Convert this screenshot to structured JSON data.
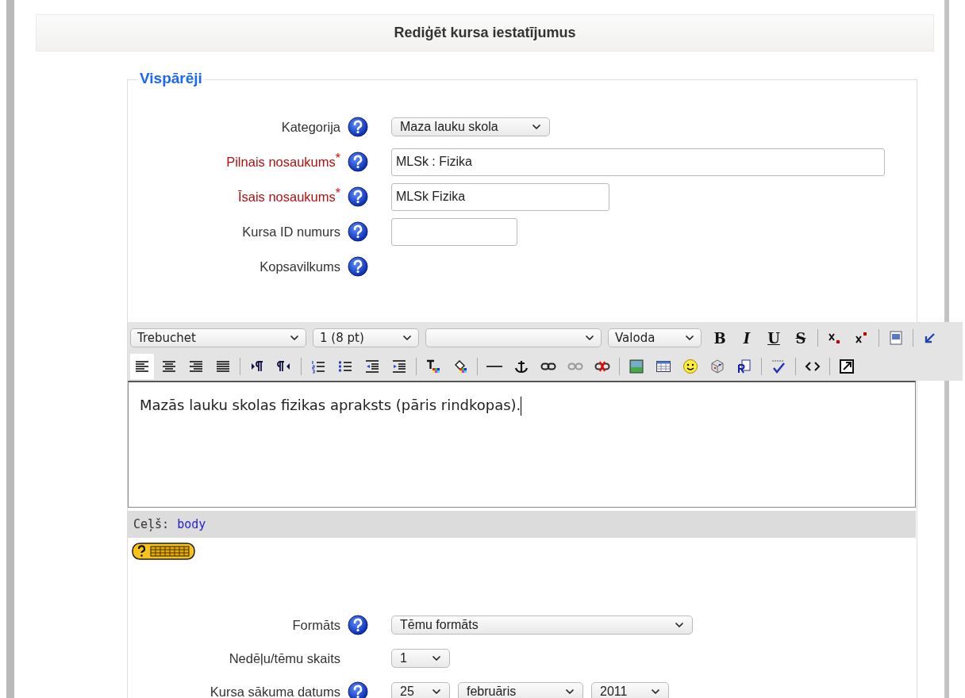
{
  "header": {
    "title": "Rediģēt kursa iestatījumus"
  },
  "section": {
    "legend": "Vispārēji"
  },
  "fields": [
    {
      "label": "Kategorija",
      "required": false,
      "help": true,
      "kind": "select",
      "value": "Maza lauku skola"
    },
    {
      "label": "Pilnais nosaukums",
      "required": true,
      "required_mark": "*",
      "help": true,
      "kind": "text",
      "value": "MLSk : Fizika"
    },
    {
      "label": "Īsais nosaukums",
      "required": true,
      "required_mark": "*",
      "help": true,
      "kind": "text",
      "value": "MLSk Fizika"
    },
    {
      "label": "Kursa ID numurs",
      "required": false,
      "help": true,
      "kind": "text"
    },
    {
      "label": "Kopsavilkums",
      "required": false,
      "help": true,
      "kind": "none"
    }
  ],
  "editor": {
    "toolbar_rows": [
      {
        "items": [
          {
            "kind": "select",
            "value": "Trebuchet"
          },
          {
            "kind": "select",
            "value": "1 (8 pt)"
          },
          {
            "kind": "select"
          },
          {
            "kind": "select",
            "value": "Valoda"
          },
          {
            "kind": "letter",
            "label": "B",
            "active": false
          },
          {
            "kind": "letter",
            "label": "I",
            "active": false
          },
          {
            "kind": "letter",
            "label": "U",
            "active": false
          },
          {
            "kind": "letter",
            "label": "S",
            "active": false
          },
          {
            "kind": "separator"
          },
          {
            "kind": "icon",
            "active": false
          },
          {
            "kind": "icon",
            "active": false
          },
          {
            "kind": "separator"
          },
          {
            "kind": "icon",
            "active": false
          },
          {
            "kind": "separator"
          },
          {
            "kind": "icon",
            "active": false
          }
        ]
      },
      {
        "items": [
          {
            "kind": "icon",
            "active": true
          },
          {
            "kind": "icon",
            "active": false
          },
          {
            "kind": "icon",
            "active": false
          },
          {
            "kind": "icon",
            "active": false
          },
          {
            "kind": "separator"
          },
          {
            "kind": "icon",
            "active": false
          },
          {
            "kind": "icon",
            "active": false
          },
          {
            "kind": "separator"
          },
          {
            "kind": "icon",
            "active": false
          },
          {
            "kind": "icon",
            "active": false
          },
          {
            "kind": "icon",
            "active": false
          },
          {
            "kind": "icon",
            "active": false
          },
          {
            "kind": "separator"
          },
          {
            "kind": "icon",
            "active": false
          },
          {
            "kind": "icon",
            "active": false
          },
          {
            "kind": "separator"
          },
          {
            "kind": "icon",
            "active": false
          },
          {
            "kind": "icon",
            "active": false
          },
          {
            "kind": "icon",
            "active": false
          },
          {
            "kind": "icon",
            "active": false
          },
          {
            "kind": "icon",
            "active": false
          },
          {
            "kind": "separator"
          },
          {
            "kind": "icon",
            "active": false
          },
          {
            "kind": "icon",
            "active": false
          },
          {
            "kind": "icon",
            "active": false
          },
          {
            "kind": "icon",
            "active": false
          },
          {
            "kind": "icon",
            "active": false
          },
          {
            "kind": "separator"
          },
          {
            "kind": "icon",
            "active": false
          },
          {
            "kind": "separator"
          },
          {
            "kind": "icon",
            "active": false
          },
          {
            "kind": "separator"
          },
          {
            "kind": "icon",
            "active": false
          }
        ]
      }
    ],
    "content": "Mazās lauku skolas fizikas apraksts (pāris rindkopas).",
    "path_label": "Ceļš:",
    "path_link": "body"
  },
  "fields_after": [
    {
      "label": "Formāts",
      "help": true,
      "kind": "select",
      "selects": [
        {
          "value": "Tēmu formāts"
        }
      ]
    },
    {
      "label": "Nedēļu/tēmu skaits",
      "help": false,
      "kind": "select",
      "selects": [
        {
          "value": "1"
        }
      ]
    },
    {
      "label": "Kursa sākuma datums",
      "help": true,
      "kind": "select",
      "selects": [
        {
          "value": "25"
        },
        {
          "value": "februāris"
        },
        {
          "value": "2011"
        }
      ]
    }
  ]
}
